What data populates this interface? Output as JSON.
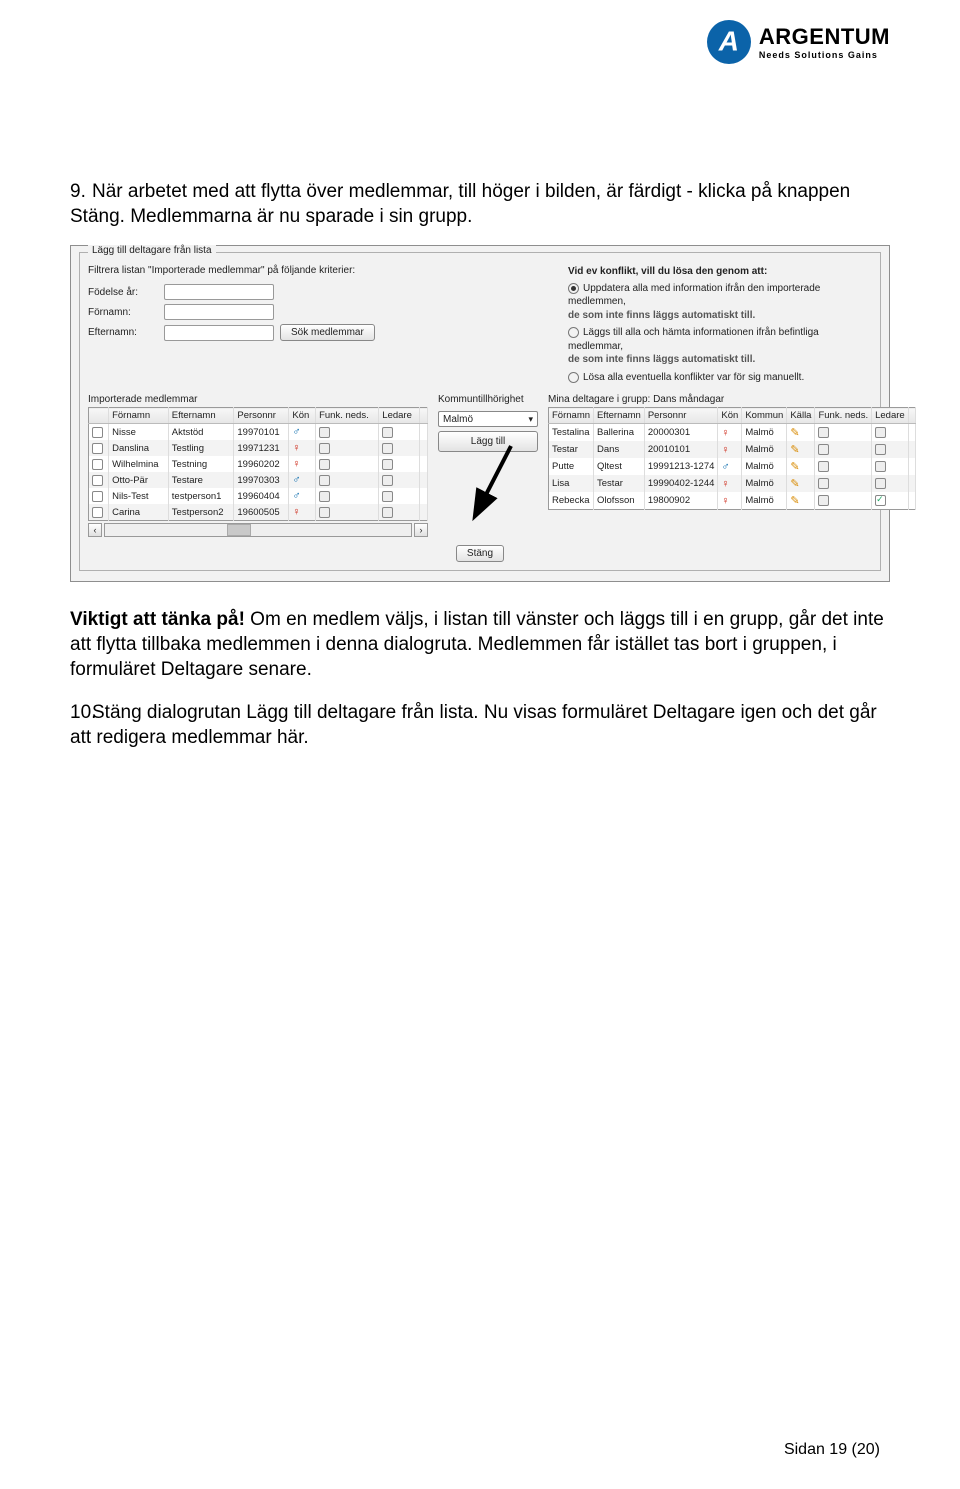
{
  "logo": {
    "name": "ARGENTUM",
    "tagline": "Needs Solutions Gains"
  },
  "instruction9": {
    "num": "9.",
    "text": "När arbetet med att flytta över medlemmar, till höger i bilden, är färdigt - klicka på knappen Stäng. Medlemmarna är nu sparade i sin grupp."
  },
  "important": {
    "heading": "Viktigt att tänka på!",
    "text": " Om en medlem väljs, i listan till vänster och läggs till i en grupp, går det inte att flytta tillbaka medlemmen i denna dialogruta. Medlemmen får istället tas bort i gruppen, i formuläret Deltagare senare."
  },
  "instruction10": {
    "num": "10.",
    "text": "Stäng dialogrutan Lägg till deltagare från lista. Nu visas formuläret Deltagare igen och det går att redigera medlemmar här."
  },
  "dialog": {
    "legend": "Lägg till deltagare från lista",
    "filter": {
      "intro": "Filtrera listan \"Importerade medlemmar\" på följande kriterier:",
      "birthYear": "Födelse år:",
      "firstName": "Förnamn:",
      "lastName": "Efternamn:",
      "searchBtn": "Sök medlemmar"
    },
    "conflict": {
      "title": "Vid ev konflikt, vill du lösa den genom att:",
      "opt1": "Uppdatera alla med information ifrån den importerade medlemmen,",
      "opt1sub": "de som inte finns läggs automatiskt till.",
      "opt2": "Läggs till alla och hämta informationen ifrån befintliga medlemmar,",
      "opt2sub": "de som inte finns läggs automatiskt till.",
      "opt3": "Lösa alla eventuella konflikter var för sig manuellt."
    },
    "leftTable": {
      "title": "Importerade medlemmar",
      "headers": [
        "",
        "Förnamn",
        "Efternamn",
        "Personnr",
        "Kön",
        "Funk. neds.",
        "Ledare",
        ""
      ],
      "rows": [
        {
          "fn": "Nisse",
          "en": "Aktstöd",
          "pn": "19970101",
          "g": "m"
        },
        {
          "fn": "Danslina",
          "en": "Testling",
          "pn": "19971231",
          "g": "f"
        },
        {
          "fn": "Wilhelmina",
          "en": "Testning",
          "pn": "19960202",
          "g": "f"
        },
        {
          "fn": "Otto-Pär",
          "en": "Testare",
          "pn": "19970303",
          "g": "m"
        },
        {
          "fn": "Nils-Test",
          "en": "testperson1",
          "pn": "19960404",
          "g": "m"
        },
        {
          "fn": "Carina",
          "en": "Testperson2",
          "pn": "19600505",
          "g": "f"
        }
      ]
    },
    "mid": {
      "kommunLabel": "Kommuntillhörighet",
      "kommunValue": "Malmö",
      "addBtn": "Lägg till"
    },
    "rightTable": {
      "title": "Mina deltagare i grupp: Dans måndagar",
      "headers": [
        "Förnamn",
        "Efternamn",
        "Personnr",
        "Kön",
        "Kommun",
        "Källa",
        "Funk. neds.",
        "Ledare",
        ""
      ],
      "rows": [
        {
          "fn": "Testalina",
          "en": "Ballerina",
          "pn": "20000301",
          "g": "f",
          "k": "Malmö"
        },
        {
          "fn": "Testar",
          "en": "Dans",
          "pn": "20010101",
          "g": "f",
          "k": "Malmö"
        },
        {
          "fn": "Putte",
          "en": "Qltest",
          "pn": "19991213-1274",
          "g": "m",
          "k": "Malmö"
        },
        {
          "fn": "Lisa",
          "en": "Testar",
          "pn": "19990402-1244",
          "g": "f",
          "k": "Malmö"
        },
        {
          "fn": "Rebecka",
          "en": "Olofsson",
          "pn": "19800902",
          "g": "f",
          "k": "Malmö",
          "ledare": true
        }
      ]
    },
    "closeBtn": "Stäng"
  },
  "footer": "Sidan 19 (20)"
}
